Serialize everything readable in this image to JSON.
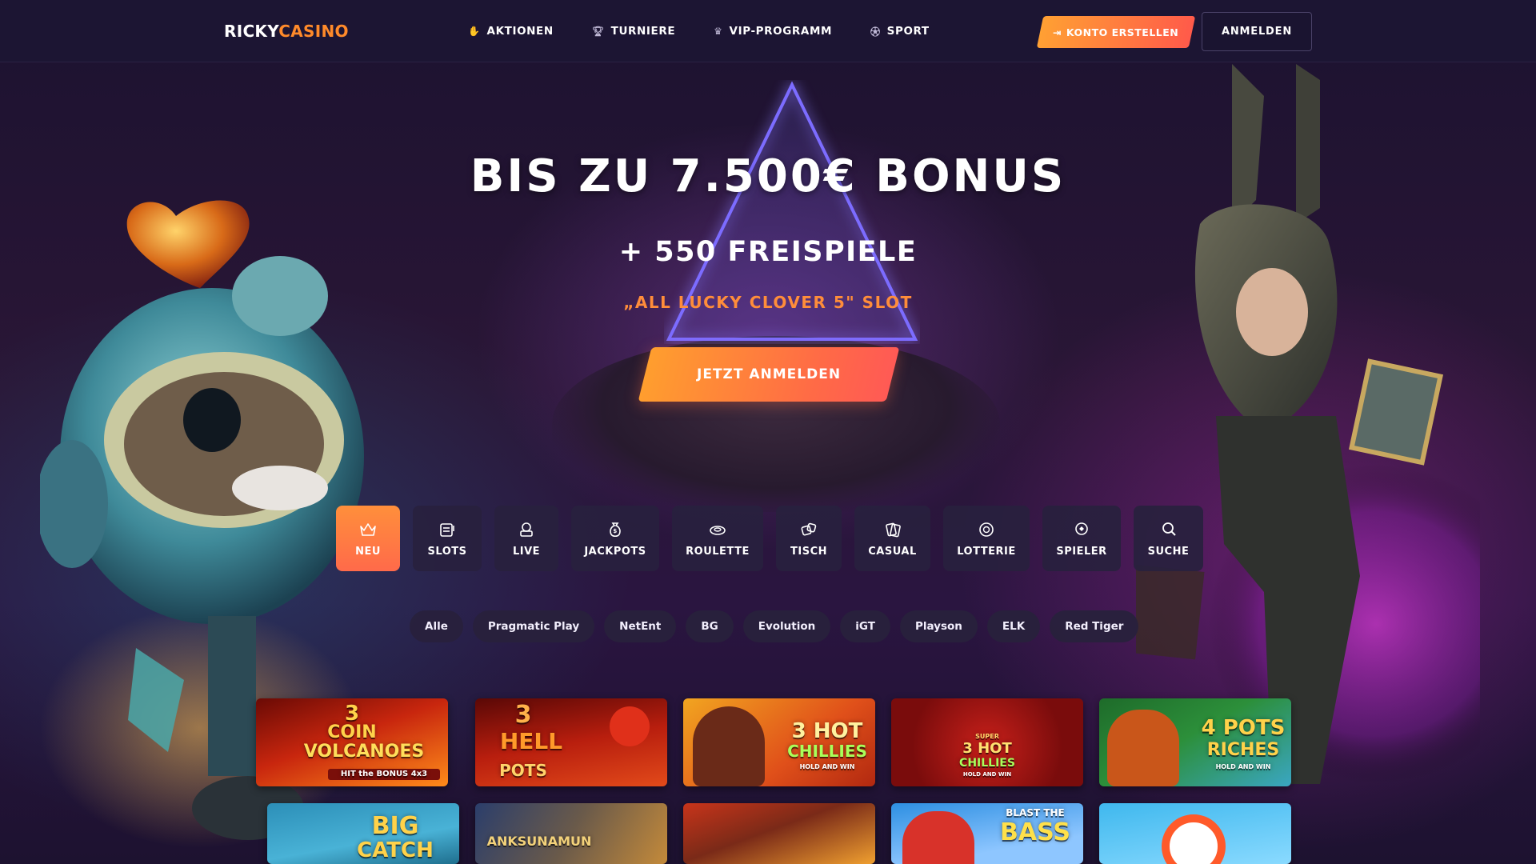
{
  "brand": {
    "part1": "RICKY",
    "part2": "CASINO"
  },
  "nav": [
    {
      "label": "AKTIONEN",
      "icon": "hand-icon"
    },
    {
      "label": "TURNIERE",
      "icon": "trophy-icon"
    },
    {
      "label": "VIP-PROGRAMM",
      "icon": "crown-icon"
    },
    {
      "label": "SPORT",
      "icon": "ball-icon"
    }
  ],
  "header": {
    "create_account": "KONTO ERSTELLEN",
    "login": "ANMELDEN"
  },
  "hero": {
    "title": "BIS ZU 7.500€ BONUS",
    "subtitle": "+ 550 FREISPIELE",
    "slot": "„ALL LUCKY CLOVER 5\" SLOT",
    "cta": "JETZT ANMELDEN"
  },
  "categories": [
    {
      "label": "NEU",
      "icon": "crown-icon",
      "active": true
    },
    {
      "label": "SLOTS",
      "icon": "slot-machine-icon"
    },
    {
      "label": "LIVE",
      "icon": "live-icon"
    },
    {
      "label": "JACKPOTS",
      "icon": "money-bag-icon"
    },
    {
      "label": "ROULETTE",
      "icon": "roulette-icon"
    },
    {
      "label": "TISCH",
      "icon": "dice-icon"
    },
    {
      "label": "CASUAL",
      "icon": "cards-icon"
    },
    {
      "label": "LOTTERIE",
      "icon": "lottery-ball-icon"
    },
    {
      "label": "SPIELER",
      "icon": "player-icon"
    },
    {
      "label": "SUCHE",
      "icon": "search-icon"
    }
  ],
  "providers": [
    "Alle",
    "Pragmatic Play",
    "NetEnt",
    "BG",
    "Evolution",
    "iGT",
    "Playson",
    "ELK",
    "Red Tiger"
  ],
  "games": [
    {
      "title_lines": [
        "3",
        "COIN",
        "VOLCANOES"
      ],
      "subtitle": "HIT the BONUS 4x3",
      "colors": [
        "#c01a0c",
        "#ff7a16"
      ]
    },
    {
      "title_lines": [
        "3",
        "HELL",
        "POTS"
      ],
      "subtitle": "",
      "colors": [
        "#8d0f08",
        "#e6451a"
      ]
    },
    {
      "title_lines": [
        "3 HOT",
        "CHILLIES"
      ],
      "subtitle": "HOLD AND WIN",
      "colors": [
        "#e07a10",
        "#b52a12"
      ]
    },
    {
      "title_lines": [
        "SUPER",
        "3 HOT",
        "CHILLIES"
      ],
      "subtitle": "HOLD AND WIN",
      "colors": [
        "#c0150f",
        "#6d0b0b"
      ]
    },
    {
      "title_lines": [
        "4 POTS",
        "RICHES"
      ],
      "subtitle": "HOLD AND WIN",
      "colors": [
        "#1f7a32",
        "#2a9bb0"
      ]
    },
    {
      "title_lines": [
        "BIG",
        "CATCH"
      ],
      "subtitle": "",
      "colors": [
        "#37a6c9",
        "#1a6d8c"
      ]
    },
    {
      "title_lines": [
        "ANKSUNAMUN"
      ],
      "subtitle": "",
      "colors": [
        "#2c4a7a",
        "#c08a3a"
      ]
    },
    {
      "title_lines": [
        ""
      ],
      "subtitle": "",
      "colors": [
        "#7a2a18",
        "#f0a030"
      ]
    },
    {
      "title_lines": [
        "BLAST THE",
        "BASS"
      ],
      "subtitle": "",
      "colors": [
        "#3aa0e8",
        "#cde8ff"
      ]
    },
    {
      "title_lines": [
        ""
      ],
      "subtitle": "",
      "colors": [
        "#3fc0f0",
        "#7fd8ff"
      ]
    }
  ]
}
